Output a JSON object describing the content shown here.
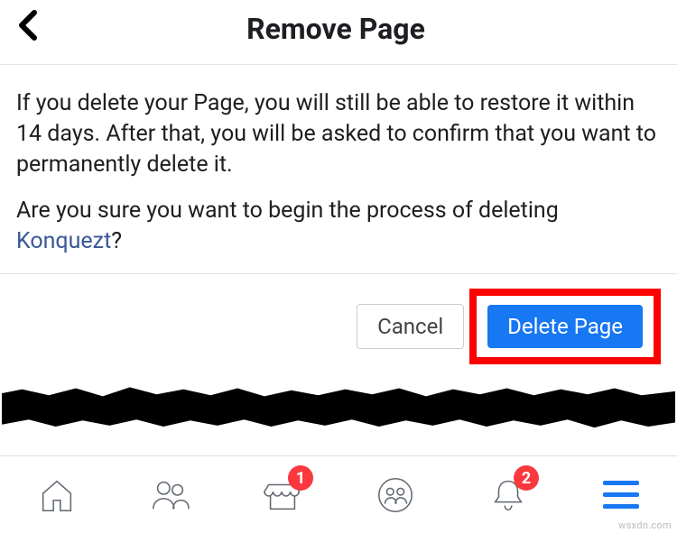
{
  "header": {
    "title": "Remove Page"
  },
  "content": {
    "paragraph1": "If you delete your Page, you will still be able to restore it within 14 days. After that, you will be asked to confirm that you want to permanently delete it.",
    "paragraph2_prefix": "Are you sure you want to begin the process of deleting ",
    "page_name": "Konquezt",
    "paragraph2_suffix": "?"
  },
  "actions": {
    "cancel_label": "Cancel",
    "delete_label": "Delete Page"
  },
  "tabbar": {
    "marketplace_badge": "1",
    "notifications_badge": "2"
  },
  "watermark": "wsxdn.com"
}
